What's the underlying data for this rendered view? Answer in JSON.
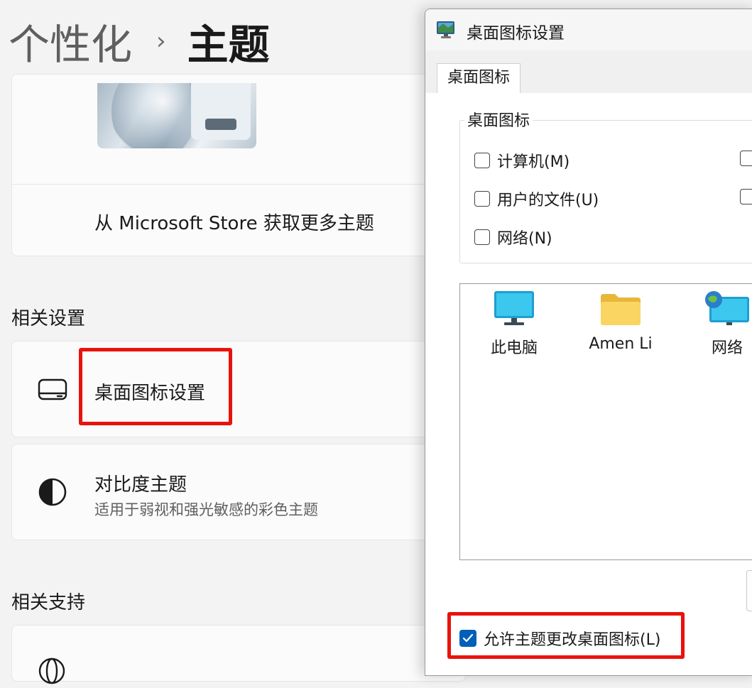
{
  "breadcrumb": {
    "parent": "个性化",
    "separator": "›",
    "current": "主题"
  },
  "theme_section": {
    "store_link": "从 Microsoft Store 获取更多主题"
  },
  "related_settings": {
    "title": "相关设置",
    "desktop_icon_settings": {
      "label": "桌面图标设置",
      "icon": "desktop-icon"
    },
    "contrast_themes": {
      "label": "对比度主题",
      "description": "适用于弱视和强光敏感的彩色主题",
      "icon": "contrast-icon"
    }
  },
  "related_support": {
    "title": "相关支持",
    "icon": "globe-icon"
  },
  "dialog": {
    "title": "桌面图标设置",
    "tab": "桌面图标",
    "group_label": "桌面图标",
    "checkboxes": [
      {
        "label": "计算机(M)",
        "checked": false
      },
      {
        "label": "用户的文件(U)",
        "checked": false
      },
      {
        "label": "网络(N)",
        "checked": false
      }
    ],
    "icons": [
      {
        "label": "此电脑",
        "icon": "monitor-icon"
      },
      {
        "label": "Amen Li",
        "icon": "folder-icon"
      },
      {
        "label": "网络",
        "icon": "network-icon"
      }
    ],
    "allow_themes": {
      "label": "允许主题更改桌面图标(L)",
      "checked": true
    }
  },
  "colors": {
    "highlight_border": "#e8130c",
    "checkbox_accent": "#005fb8",
    "page_background": "#f3f3f3"
  }
}
